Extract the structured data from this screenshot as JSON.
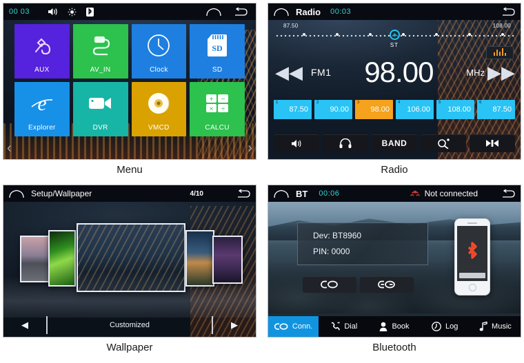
{
  "panels": {
    "menu": {
      "caption": "Menu",
      "statusbar": {
        "time": "00 03",
        "icons": [
          "volume-icon",
          "brightness-icon",
          "bluetooth-icon"
        ],
        "right_icons": [
          "home-icon",
          "back-icon"
        ]
      },
      "tiles": [
        {
          "label": "AUX",
          "icon": "aux-plug-icon",
          "color": "#5522DD"
        },
        {
          "label": "AV_IN",
          "icon": "av-cable-icon",
          "color": "#2DC14E"
        },
        {
          "label": "Clock",
          "icon": "clock-icon",
          "color": "#1E7FE0"
        },
        {
          "label": "SD",
          "icon": "sd-card-icon",
          "color": "#1E7FE0"
        },
        {
          "label": "Explorer",
          "icon": "explorer-e-icon",
          "color": "#1790E8"
        },
        {
          "label": "DVR",
          "icon": "camcorder-icon",
          "color": "#17B5A5"
        },
        {
          "label": "VMCD",
          "icon": "disc-icon",
          "color": "#D9A200"
        },
        {
          "label": "CALCU",
          "icon": "calculator-icon",
          "color": "#2DC14E"
        }
      ],
      "prev_arrow": "‹",
      "next_arrow": "›"
    },
    "radio": {
      "caption": "Radio",
      "statusbar": {
        "home_icon": "home-icon",
        "title": "Radio",
        "time": "00:03",
        "back_icon": "back-icon"
      },
      "scale_min": "87.50",
      "scale_max": "108.00",
      "stereo_label": "ST",
      "eq_icon": "equalizer-icon",
      "prev_icon": "rewind-icon",
      "next_icon": "forward-icon",
      "band": "FM1",
      "frequency": "98.00",
      "unit": "MHz",
      "presets": [
        {
          "n": "1",
          "value": "87.50",
          "active": false
        },
        {
          "n": "2",
          "value": "90.00",
          "active": false
        },
        {
          "n": "3",
          "value": "98.00",
          "active": true
        },
        {
          "n": "4",
          "value": "106.00",
          "active": false
        },
        {
          "n": "5",
          "value": "108.00",
          "active": false
        },
        {
          "n": "6",
          "value": "87.50",
          "active": false
        }
      ],
      "controls": [
        {
          "label": "",
          "icon": "speaker-icon"
        },
        {
          "label": "",
          "icon": "headphone-icon"
        },
        {
          "label": "BAND",
          "icon": ""
        },
        {
          "label": "",
          "icon": "search-plus-icon"
        },
        {
          "label": "",
          "icon": "scan-icon"
        }
      ]
    },
    "wallpaper": {
      "caption": "Wallpaper",
      "statusbar": {
        "home_icon": "home-icon",
        "title": "Setup/Wallpaper",
        "page": "4/10",
        "back_icon": "back-icon"
      },
      "prev_arrow": "◀",
      "next_arrow": "▶",
      "mode_label": "Customized"
    },
    "bluetooth": {
      "caption": "Bluetooth",
      "statusbar": {
        "home_icon": "home-icon",
        "title": "BT",
        "time": "00:06",
        "status_icon": "disconnected-icon",
        "status": "Not connected",
        "back_icon": "back-icon"
      },
      "device_line": "Dev: BT8960",
      "pin_line": "PIN: 0000",
      "buttons": [
        {
          "icon": "link-icon"
        },
        {
          "icon": "unlink-icon"
        }
      ],
      "phone_icon": "bluetooth-phone-icon",
      "tabs": [
        {
          "label": "Conn.",
          "icon": "link-icon",
          "active": true
        },
        {
          "label": "Dial",
          "icon": "phone-icon",
          "active": false
        },
        {
          "label": "Book",
          "icon": "contact-icon",
          "active": false
        },
        {
          "label": "Log",
          "icon": "clock-icon",
          "active": false
        },
        {
          "label": "Music",
          "icon": "music-note-icon",
          "active": false
        }
      ]
    }
  },
  "colors": {
    "accent_blue": "#1194e0",
    "preset_blue": "#29c3f5",
    "preset_active": "#f5a21c",
    "time_cyan": "#2fd6d6",
    "status_red": "#e03a3a"
  }
}
